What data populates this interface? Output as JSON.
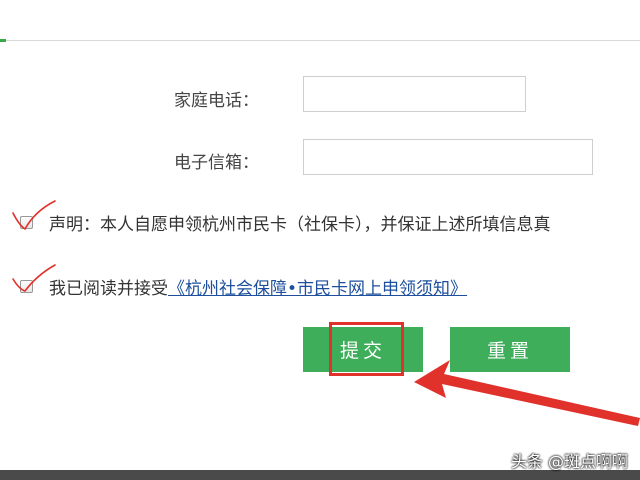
{
  "form": {
    "home_phone_label": "家庭电话：",
    "home_phone_value": "",
    "email_label": "电子信箱：",
    "email_value": ""
  },
  "declaration": {
    "text": "声明：本人自愿申领杭州市民卡（社保卡），并保证上述所填信息真",
    "checked": false
  },
  "agreement": {
    "prefix": "我已阅读并接受",
    "link_text": "《杭州社会保障•市民卡网上申领须知》",
    "checked": false
  },
  "actions": {
    "submit_label": "提交",
    "reset_label": "重置"
  },
  "annotation_colors": {
    "accent_green": "#3fae5a",
    "highlight_red": "#e0312b"
  },
  "watermark": "头条 @斑点啊啊"
}
